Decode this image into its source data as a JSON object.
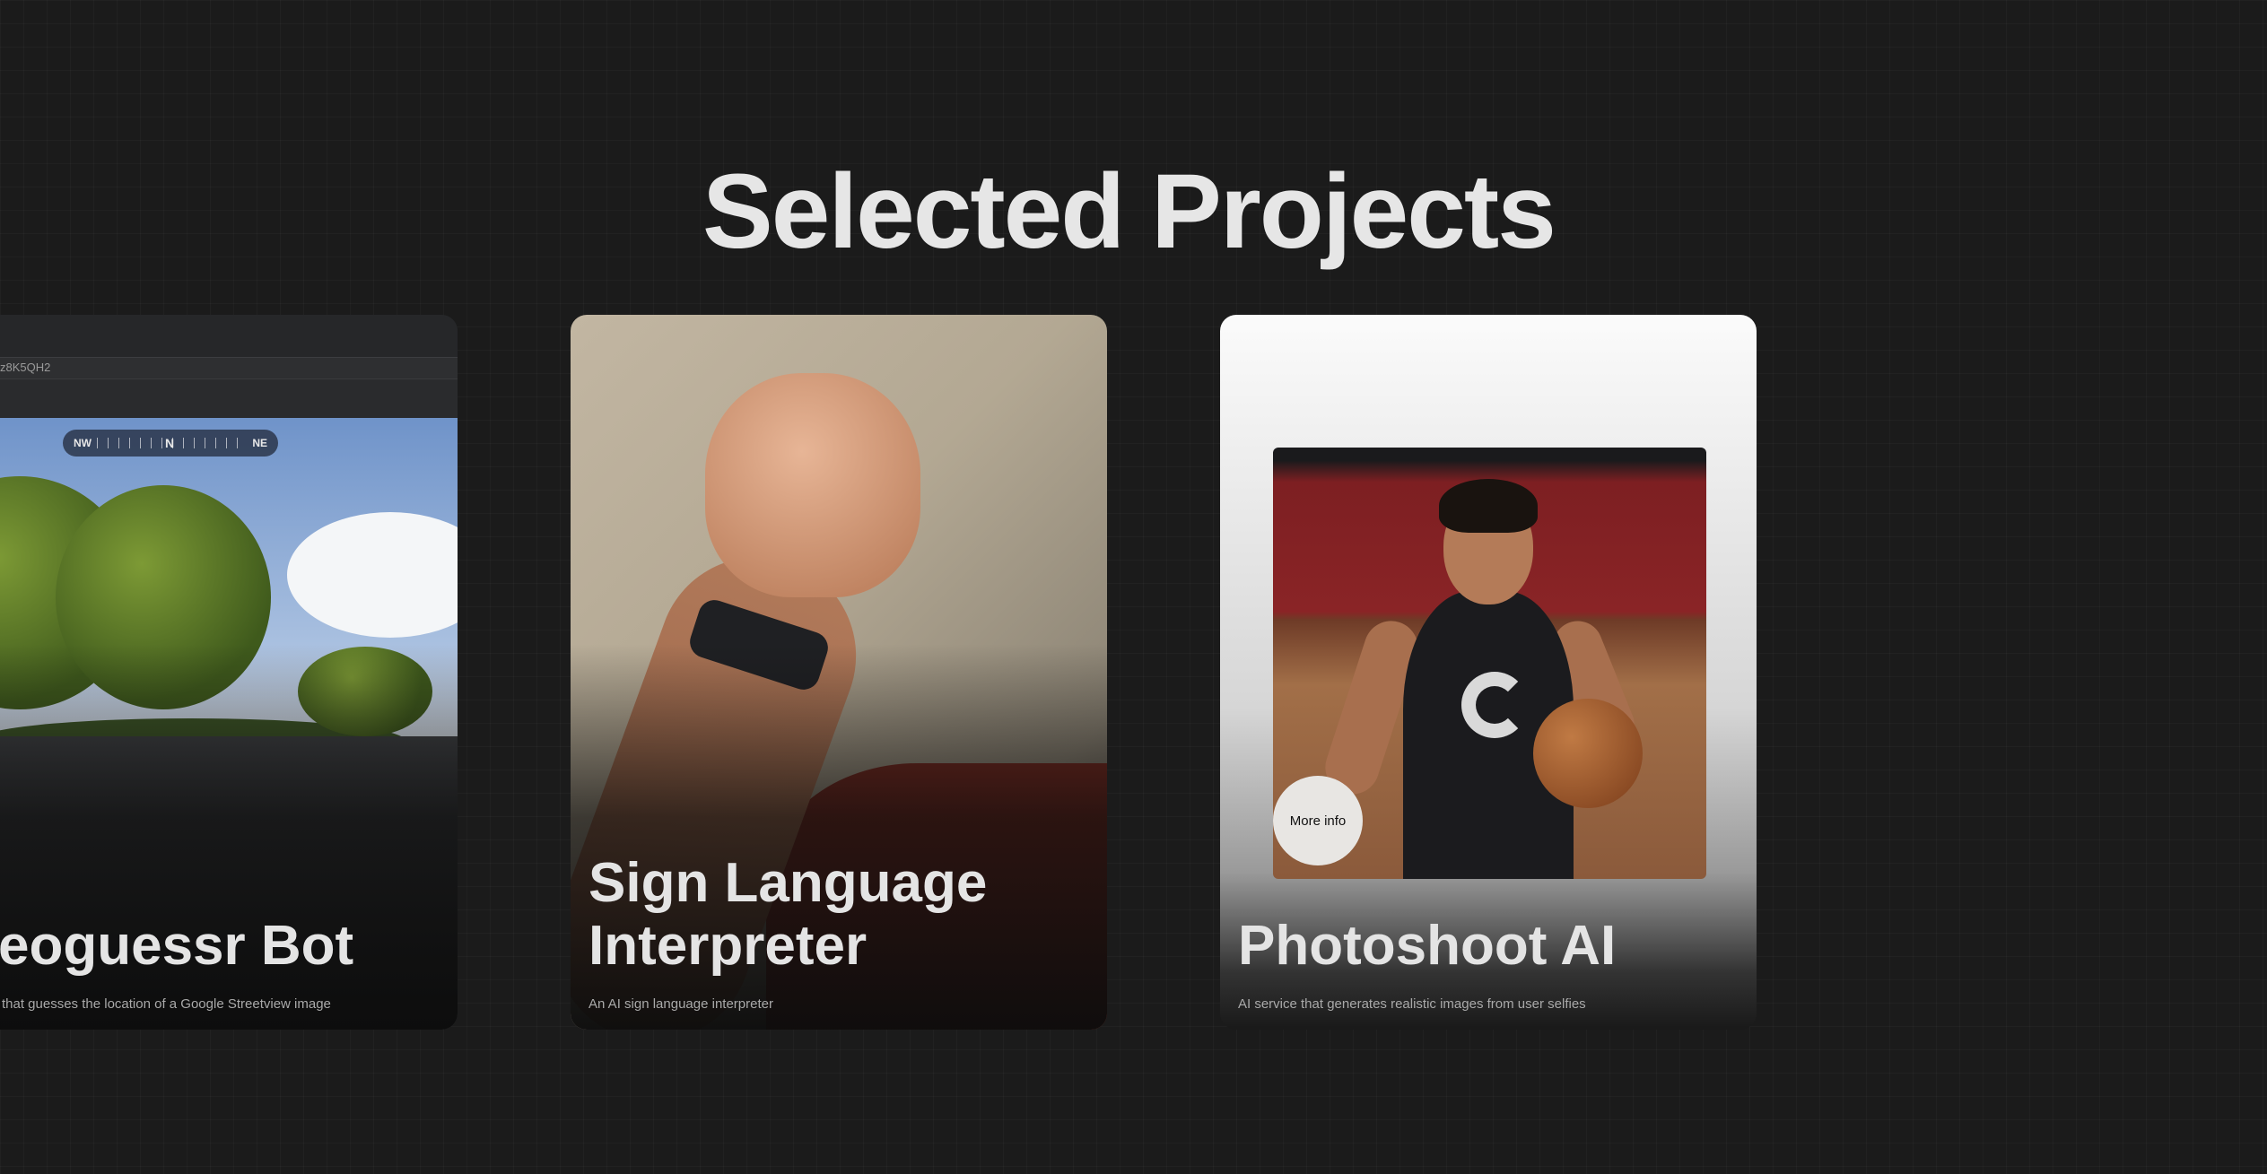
{
  "section": {
    "title": "Selected Projects"
  },
  "projects": [
    {
      "title": "Geoguessr Bot",
      "title_visible": "eoguessr Bot",
      "description": "that guesses the location of a Google Streetview image",
      "screenshot": {
        "address_text": "z8K5QH2",
        "compass": {
          "left": "NW",
          "center": "N",
          "right": "NE"
        }
      }
    },
    {
      "title_line1": "Sign Language",
      "title_line2": "Interpreter",
      "description": "An AI sign language interpreter"
    },
    {
      "title": "Photoshoot AI",
      "description": "AI service that generates realistic images from user selfies",
      "more_info_label": "More info"
    }
  ]
}
